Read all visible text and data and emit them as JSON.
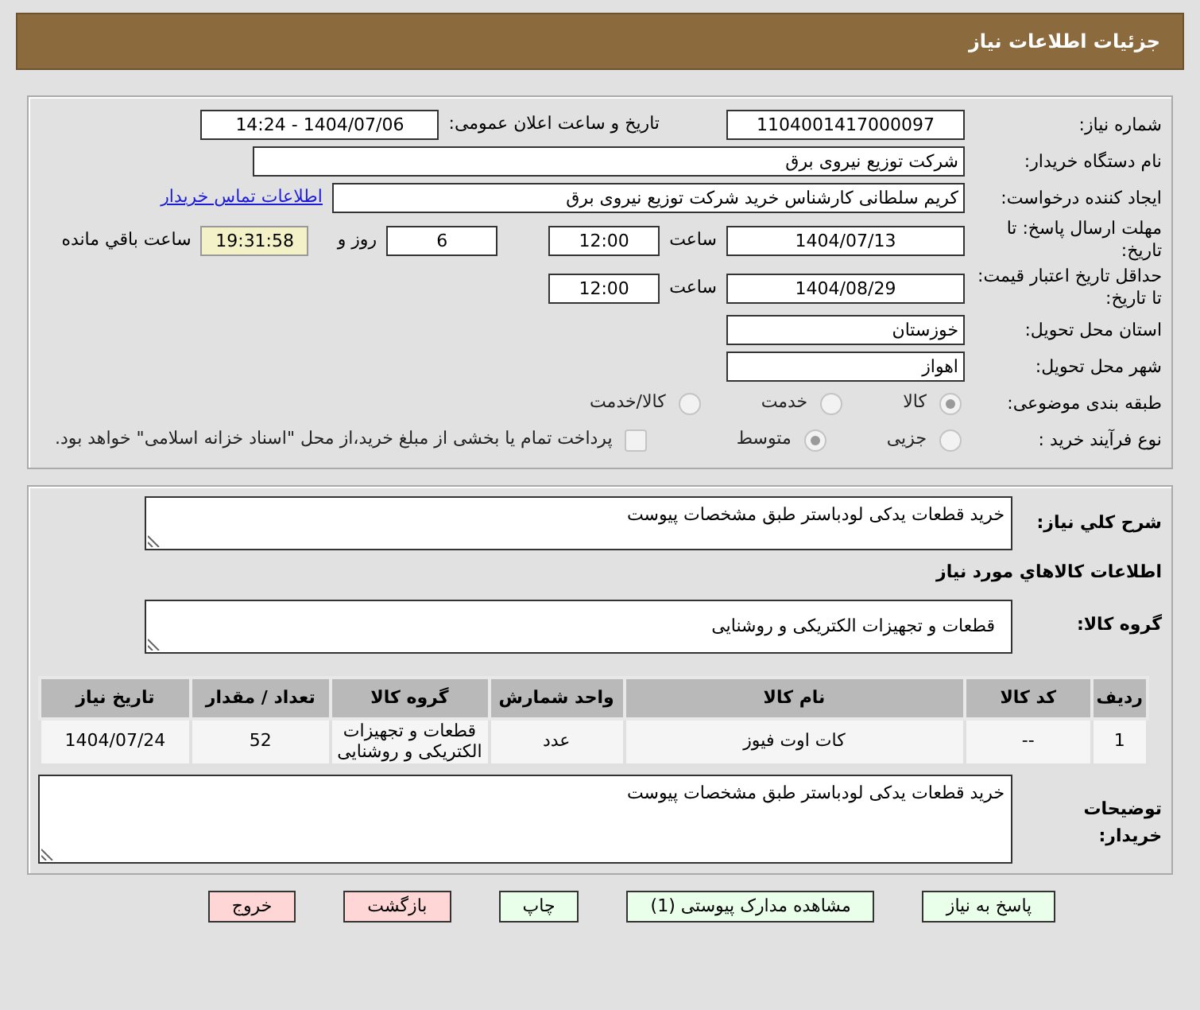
{
  "title": "جزئیات اطلاعات نیاز",
  "need_number": {
    "label": "شماره نیاز:",
    "value": "1104001417000097"
  },
  "announce": {
    "label": "تاریخ و ساعت اعلان عمومی:",
    "value": "1404/07/06 - 14:24"
  },
  "buyer": {
    "label": "نام دستگاه خریدار:",
    "value": "شرکت توزیع نیروی برق"
  },
  "requester": {
    "label": "ایجاد کننده درخواست:",
    "value": "کریم  سلطانی کارشناس خرید  شرکت توزیع نیروی برق",
    "link": "اطلاعات تماس خریدار"
  },
  "deadline": {
    "label": "مهلت ارسال پاسخ: تا تاریخ:",
    "date": "1404/07/13",
    "time_label": "ساعت",
    "time": "12:00",
    "days": "6",
    "days_label": "روز و",
    "remaining": "19:31:58",
    "remaining_label": "ساعت باقي مانده"
  },
  "validity": {
    "label": "حداقل تاریخ اعتبار قیمت: تا تاریخ:",
    "date": "1404/08/29",
    "time_label": "ساعت",
    "time": "12:00"
  },
  "province": {
    "label": "استان محل تحویل:",
    "value": "خوزستان"
  },
  "city": {
    "label": "شهر محل تحویل:",
    "value": "اهواز"
  },
  "category": {
    "label": "طبقه بندی موضوعی:",
    "options": [
      {
        "label": "کالا",
        "selected": true
      },
      {
        "label": "خدمت",
        "selected": false
      },
      {
        "label": "کالا/خدمت",
        "selected": false
      }
    ]
  },
  "process": {
    "label": "نوع فرآیند خرید :",
    "options": [
      {
        "label": "جزیی",
        "selected": false
      },
      {
        "label": "متوسط",
        "selected": true
      }
    ],
    "checkbox": {
      "label": "پرداخت تمام یا بخشی از مبلغ خرید،از محل \"اسناد خزانه اسلامی\" خواهد بود.",
      "checked": false
    }
  },
  "summary": {
    "label": "شرح کلي نياز:",
    "value": "خرید قطعات یدکی لودباستر طبق مشخصات پیوست"
  },
  "goods_heading": "اطلاعات کالاهاي مورد نياز",
  "goods_group": {
    "label": "گروه کالا:",
    "value": "قطعات و تجهیزات الکتریکی و روشنایی"
  },
  "table": {
    "columns": [
      "ردیف",
      "کد کالا",
      "نام کالا",
      "واحد شمارش",
      "گروه کالا",
      "تعداد / مقدار",
      "تاریخ نیاز"
    ],
    "rows": [
      [
        "1",
        "--",
        "کات اوت فیوز",
        "عدد",
        "قطعات و تجهیزات الکتریکی و روشنایی",
        "52",
        "1404/07/24"
      ]
    ]
  },
  "notes": {
    "label": "توضیحات خریدار:",
    "value": "خرید قطعات یدکی لودباستر طبق مشخصات پیوست"
  },
  "buttons": [
    {
      "label": "پاسخ به نیاز",
      "kind": "go"
    },
    {
      "label": "مشاهده مدارک پیوستی (1)",
      "kind": "go"
    },
    {
      "label": "چاپ",
      "kind": "go"
    },
    {
      "label": "بازگشت",
      "kind": "stop"
    },
    {
      "label": "خروج",
      "kind": "stop"
    }
  ]
}
